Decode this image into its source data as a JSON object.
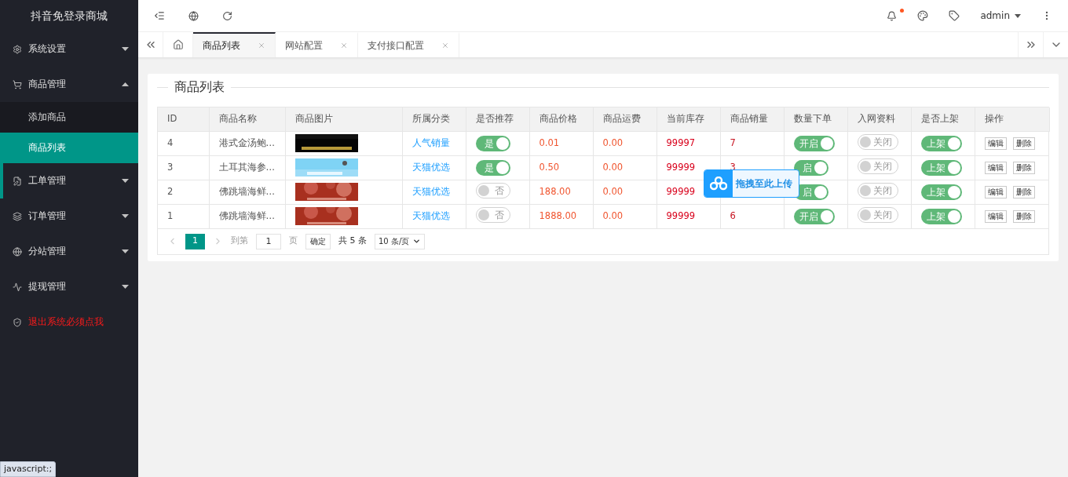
{
  "sidebar": {
    "title": "抖音免登录商城",
    "items": [
      {
        "label": "系统设置",
        "kind": "menu",
        "expanded": false,
        "highlighted": false
      },
      {
        "label": "商品管理",
        "kind": "menu",
        "expanded": true,
        "highlighted": false,
        "children": [
          {
            "label": "添加商品",
            "selected": false
          },
          {
            "label": "商品列表",
            "selected": true
          }
        ]
      },
      {
        "label": "工单管理",
        "kind": "menu",
        "expanded": false,
        "highlighted": true
      },
      {
        "label": "订单管理",
        "kind": "menu",
        "expanded": false,
        "highlighted": false
      },
      {
        "label": "分站管理",
        "kind": "menu",
        "expanded": false,
        "highlighted": false
      },
      {
        "label": "提现管理",
        "kind": "menu",
        "expanded": false,
        "highlighted": false
      },
      {
        "label": "退出系统必须点我",
        "kind": "danger",
        "highlighted": false
      }
    ]
  },
  "topbar": {
    "user": "admin",
    "notification_dot": true
  },
  "tabs": [
    {
      "label": "商品列表",
      "selected": true
    },
    {
      "label": "网站配置",
      "selected": false
    },
    {
      "label": "支付接口配置",
      "selected": false
    }
  ],
  "card": {
    "title": "商品列表"
  },
  "table": {
    "columns": [
      "ID",
      "商品名称",
      "商品图片",
      "所属分类",
      "是否推荐",
      "商品价格",
      "商品运费",
      "当前库存",
      "商品销量",
      "数量下单",
      "入网资料",
      "是否上架",
      "操作"
    ],
    "rows": [
      {
        "id": "4",
        "name": "港式金汤鲍…",
        "image": {
          "kind": "picture"
        },
        "category": "人气销量",
        "recommend": {
          "label": "是",
          "on": true
        },
        "price": "0.01",
        "shipping": "0.00",
        "stock": "99997",
        "sales": "7",
        "order_qty": {
          "label": "开启",
          "on": true
        },
        "network": {
          "label": "关闭",
          "on": false
        },
        "listed": {
          "label": "上架",
          "on": true
        },
        "actions": [
          "编辑",
          "删除"
        ]
      },
      {
        "id": "3",
        "name": "土耳其海参…",
        "image": {
          "kind": "picture"
        },
        "category": "天猫优选",
        "recommend": {
          "label": "是",
          "on": true
        },
        "price": "0.50",
        "shipping": "0.00",
        "stock": "99999",
        "sales": "3",
        "order_qty": {
          "label": "启",
          "on": true
        },
        "network": {
          "label": "关闭",
          "on": false
        },
        "listed": {
          "label": "上架",
          "on": true
        },
        "actions": [
          "编辑",
          "删除"
        ]
      },
      {
        "id": "2",
        "name": "佛跳墙海鲜…",
        "image": {
          "kind": "picture"
        },
        "category": "天猫优选",
        "recommend": {
          "label": "否",
          "on": false
        },
        "price": "188.00",
        "shipping": "0.00",
        "stock": "99999",
        "order_qty": {
          "label": "启",
          "on": true
        },
        "network": {
          "label": "关闭",
          "on": false
        },
        "listed": {
          "label": "上架",
          "on": true
        },
        "actions": [
          "编辑",
          "删除"
        ]
      },
      {
        "id": "1",
        "name": "佛跳墙海鲜…",
        "image": {
          "kind": "picture"
        },
        "category": "天猫优选",
        "recommend": {
          "label": "否",
          "on": false
        },
        "price": "1888.00",
        "shipping": "0.00",
        "stock": "99999",
        "sales": "6",
        "order_qty": {
          "label": "开启",
          "on": true
        },
        "network": {
          "label": "关闭",
          "on": false
        },
        "listed": {
          "label": "上架",
          "on": true
        },
        "actions": [
          "编辑",
          "删除"
        ]
      }
    ]
  },
  "pagination": {
    "pages": [
      {
        "label": "1",
        "selected": true
      }
    ],
    "goto_label": "到第",
    "goto_value": "1",
    "page_unit": "页",
    "confirm": "确定",
    "total": "共 5 条",
    "page_size": "10 条/页"
  },
  "upload_overlay": {
    "label": "拖拽至此上传"
  },
  "status_tooltip": "javascript:;"
}
